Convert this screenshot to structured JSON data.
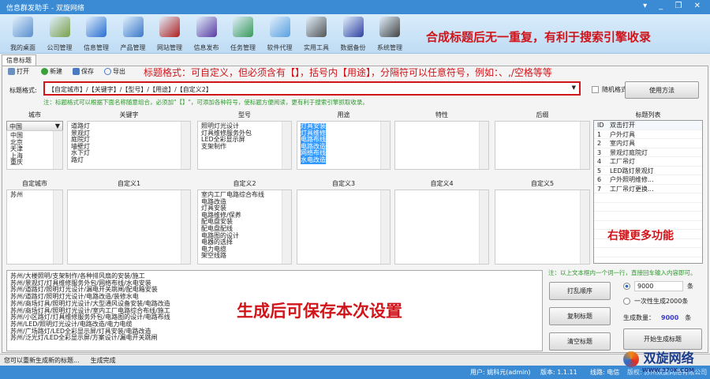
{
  "window": {
    "title": "信息群发助手 - 双旋网络",
    "controls": "▾ _ ❐ ✕"
  },
  "toolbar": {
    "items": [
      {
        "label": "我的桌面",
        "color": "#5a8fcf"
      },
      {
        "label": "公司管理",
        "color": "#7aa04a"
      },
      {
        "label": "信息管理",
        "color": "#2a6fd0"
      },
      {
        "label": "产品管理",
        "color": "#3a78c8"
      },
      {
        "label": "网站管理",
        "color": "#b02020"
      },
      {
        "label": "信息发布",
        "color": "#5a3aa0"
      },
      {
        "label": "任务管理",
        "color": "#3a9a5a"
      },
      {
        "label": "软件代理",
        "color": "#5aa0e0"
      },
      {
        "label": "实用工具",
        "color": "#555555"
      },
      {
        "label": "数据备份",
        "color": "#3040a0"
      },
      {
        "label": "系统管理",
        "color": "#444444"
      }
    ],
    "slogan": "合成标题后无一重复，有利于搜索引擎收录"
  },
  "tab": "信息标题",
  "actions": {
    "open": "打开",
    "new": "新建",
    "save": "保存",
    "export": "导出"
  },
  "hint": "标题格式：可自定义，但必须含有【】，括号内【用途】，分隔符可以任意符号，例如：、,/空格等等",
  "format": {
    "label": "标题格式:",
    "value": "【自定城市】/【关键字】/【型号】/【用途】/【自定义2】",
    "random": "随机格式",
    "help_button": "使用方法",
    "note": "注：标题格式可以根据下面名称随意组合，必须加\"【】\"，可添加各种符号，使标题方便阅读，更有利于搜索引擎抓取收录。"
  },
  "columns": {
    "city": {
      "header": "城市",
      "selected": "中国",
      "items": [
        "中国",
        "北京",
        "天津",
        "上海",
        "重庆"
      ]
    },
    "keyword": {
      "header": "关键字",
      "items": [
        "道路灯",
        "景观灯",
        "庭院灯",
        "墙壁灯",
        "水下灯",
        "路灯"
      ]
    },
    "model": {
      "header": "型号",
      "items": [
        "照明灯光设计",
        "灯具维修服务外包",
        "LED全彩显示屏",
        "支架制作"
      ]
    },
    "usage": {
      "header": "用途",
      "items": [
        "灯具安装",
        "灯具维修",
        "电路布线",
        "电路改造",
        "网络布线",
        "水电改造"
      ]
    },
    "feature": {
      "header": "特性"
    },
    "suffix": {
      "header": "后缀"
    },
    "custom_city": {
      "header": "自定城市",
      "items": [
        "苏州"
      ]
    },
    "custom1": {
      "header": "自定义1"
    },
    "custom2": {
      "header": "自定义2",
      "items": [
        "室内工厂电路综合布线",
        "电路改造",
        "灯具安装",
        "电路维修/保养",
        "配电盘安装",
        "配电盘配线",
        "电路图的设计",
        "电器的选择",
        "电力电缆",
        "架空线路"
      ]
    },
    "custom3": {
      "header": "自定义3"
    },
    "custom4": {
      "header": "自定义4"
    },
    "custom5": {
      "header": "自定义5"
    }
  },
  "title_list": {
    "header": "标题列表",
    "col_id": "ID",
    "col_name": "双击打开",
    "rows": [
      {
        "id": "1",
        "name": "户外灯具"
      },
      {
        "id": "2",
        "name": "室内灯具"
      },
      {
        "id": "3",
        "name": "景观灯庭院灯"
      },
      {
        "id": "4",
        "name": "工厂吊灯"
      },
      {
        "id": "5",
        "name": "LED路灯景观灯"
      },
      {
        "id": "6",
        "name": "户外照明维修..."
      },
      {
        "id": "7",
        "name": "工厂吊灯更换..."
      }
    ],
    "annotation": "右键更多功能"
  },
  "output": {
    "lines": [
      "苏州/大楼照明/支架制作/各种排风扇的安装/施工",
      "苏州/景观灯/灯具维修服务外包/网络布线/水电安装",
      "苏州/道路灯/照明灯光设计/漏电开关跳闸/配电箱安装",
      "苏州/道路灯/照明灯光设计/电路改造/装修水电",
      "苏州/商场灯具/照明灯光设计/大型通风设备安装/电路改造",
      "苏州/商场灯具/照明灯光设计/室内工厂电路综合布线/施工",
      "苏州/小区路灯/灯具维修服务外包/电路图的设计/电路布线",
      "苏州/LED/照明灯光设计/电路改造/电力电缆",
      "苏州/广场路灯/LED全彩显示屏/灯具安装/电路改造",
      "苏州/泛光灯/LED全彩显示屏/方案设计/漏电开关跳闸"
    ],
    "annotation": "生成后可保存本次设置"
  },
  "controls": {
    "note": "注：以上文本框内一个词一行，直接回车输入内容即可。",
    "shuffle": "打乱顺序",
    "copy": "复制标题",
    "clear": "清空标题",
    "count_value": "9000",
    "unit": "条",
    "once_option": "一次性生成2000条",
    "gen_label": "生成数量：",
    "gen_count": "9000",
    "start": "开始生成标题"
  },
  "status": {
    "left": "您可以重新生成新的标题...",
    "right": "生成完成"
  },
  "footer": {
    "user": "用户: 姚科元(admin)",
    "version": "版本: 1.1.11",
    "line": "线路: 电信",
    "company": "版权: 苏州双旋网络有限公司"
  },
  "logo": {
    "name": "双旋网络",
    "url": "WWW.370K.COM"
  }
}
